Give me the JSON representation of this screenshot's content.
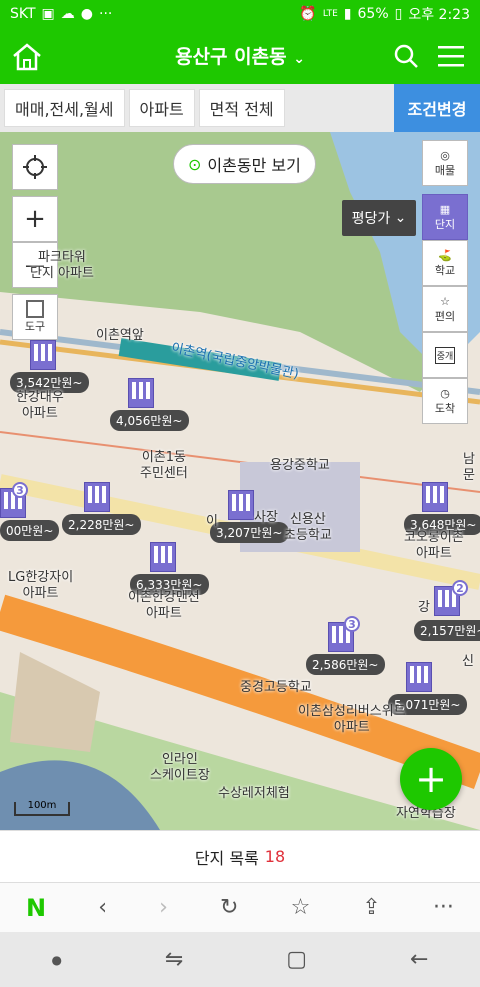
{
  "status": {
    "carrier": "SKT",
    "battery": "65%",
    "time": "오후 2:23",
    "dots": "···",
    "lte": "LTE"
  },
  "appbar": {
    "title": "용산구 이촌동"
  },
  "filters": {
    "deal": "매매,전세,월세",
    "type": "아파트",
    "area": "면적 전체",
    "change": "조건변경"
  },
  "map": {
    "pill": "이촌동만 보기",
    "pricetype": "평당가",
    "zoom_in": "+",
    "zoom_out": "—",
    "tool": "도구",
    "right_tools": [
      "매물",
      "단지",
      "학교",
      "편의",
      "중개",
      "도착"
    ],
    "scale": "100m",
    "labels": {
      "station": "이촌역(국립중앙박물관)",
      "station_front": "이촌역앞",
      "park_tower": "파크타워\n단지 아파트",
      "hangang": "한강대우\n아파트",
      "chonsa": "이촌1동\n주민센터",
      "yonggang": "용강중학교",
      "sinyongsan": "신용산\n초등학교",
      "lg": "LG한강자이\n아파트",
      "hangang_mansion": "이촌한강맨션\n아파트",
      "koho": "코오롱이촌\n아파트",
      "jungkyung": "중경고등학교",
      "samsung": "이촌삼성리버스위트\n아파트",
      "skate": "인라인\n스케이트장",
      "water": "수상레저체험",
      "nature": "자연학습장",
      "namun": "남문",
      "shin": "신",
      "gang": "강",
      "ichon_office": "이",
      "city_office": "사장"
    },
    "prices": [
      "3,542만원~",
      "4,056만원~",
      "00만원~",
      "2,228만원~",
      "3,207만원~",
      "3,648만원~",
      "6,333만원~",
      "2,157만원~",
      "2,586만원~",
      "5,071만원~"
    ],
    "counts": [
      "3",
      "3",
      "2"
    ]
  },
  "list": {
    "label": "단지 목록",
    "count": "18"
  },
  "browser": {
    "logo": "N"
  }
}
